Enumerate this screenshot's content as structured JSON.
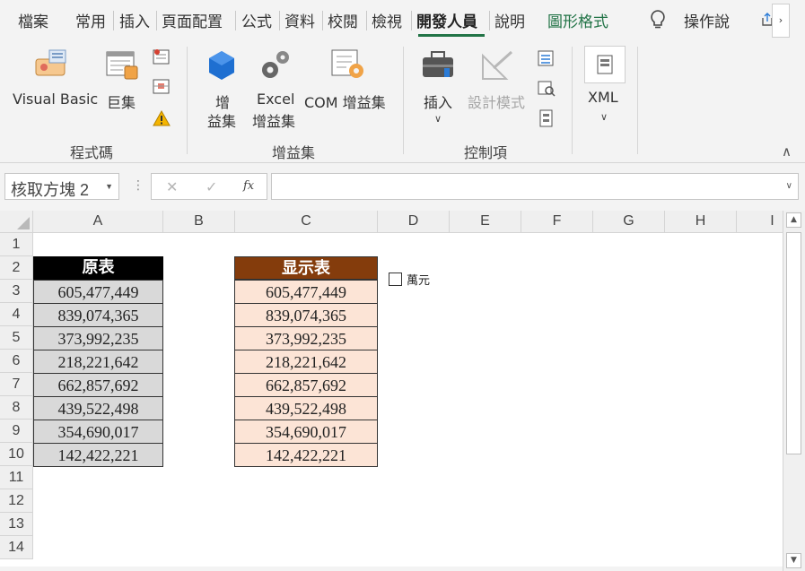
{
  "tabs": [
    {
      "label": "檔案"
    },
    {
      "label": "常用"
    },
    {
      "label": "插入"
    },
    {
      "label": "頁面配置"
    },
    {
      "label": "公式"
    },
    {
      "label": "資料"
    },
    {
      "label": "校閱"
    },
    {
      "label": "檢視"
    },
    {
      "label": "開發人員"
    },
    {
      "label": "說明"
    },
    {
      "label": "圖形格式"
    }
  ],
  "tell_me": "操作說",
  "ribbon": {
    "code_group": {
      "visual_basic": "Visual Basic",
      "macros": "巨集",
      "label": "程式碼"
    },
    "addins_group": {
      "addins_line1": "增",
      "addins_line2": "益集",
      "excel_addins_line1": "Excel",
      "excel_addins_line2": "增益集",
      "com_addins": "COM 增益集",
      "label": "增益集"
    },
    "controls_group": {
      "insert": "插入",
      "design_mode": "設計模式",
      "label": "控制項"
    },
    "xml_group": {
      "xml": "XML"
    }
  },
  "formula_bar": {
    "name_box": "核取方塊 2",
    "fx": "fx",
    "cancel": "✕",
    "enter": "✓",
    "formula": ""
  },
  "columns": [
    "A",
    "B",
    "C",
    "D",
    "E",
    "F",
    "G",
    "H",
    "I"
  ],
  "rows": [
    "1",
    "2",
    "3",
    "4",
    "5",
    "6",
    "7",
    "8",
    "9",
    "10",
    "11",
    "12",
    "13",
    "14"
  ],
  "table_a": {
    "header": "原表",
    "values": [
      "605,477,449",
      "839,074,365",
      "373,992,235",
      "218,221,642",
      "662,857,692",
      "439,522,498",
      "354,690,017",
      "142,422,221"
    ]
  },
  "table_c": {
    "header": "显示表",
    "values": [
      "605,477,449",
      "839,074,365",
      "373,992,235",
      "218,221,642",
      "662,857,692",
      "439,522,498",
      "354,690,017",
      "142,422,221"
    ]
  },
  "checkbox": {
    "label": "萬元",
    "checked": false
  },
  "colors": {
    "accent": "#217346",
    "header_a": "#000000",
    "header_c": "#843c0c",
    "cell_a": "#d9d9d9",
    "cell_c": "#fce4d6"
  }
}
